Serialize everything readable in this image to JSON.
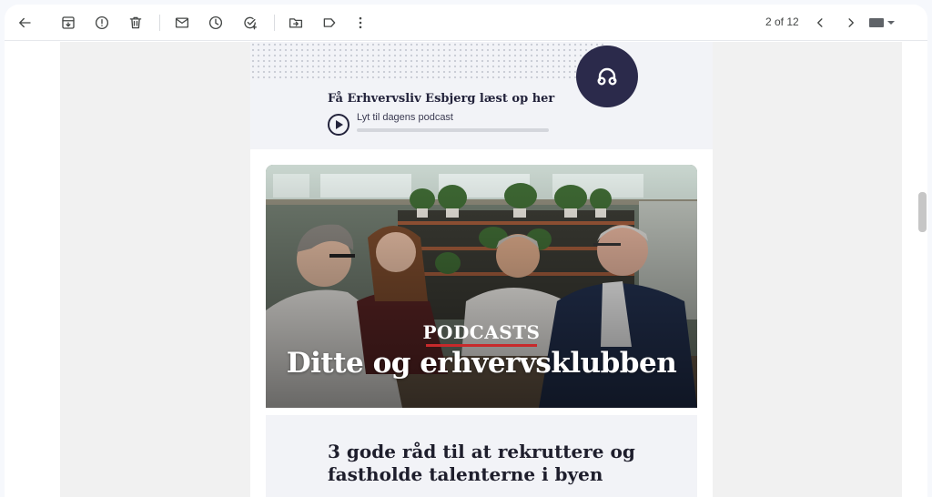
{
  "toolbar": {
    "back_icon": "arrow-left-icon",
    "archive_icon": "archive-icon",
    "spam_icon": "report-spam-icon",
    "delete_icon": "trash-icon",
    "mark_unread_icon": "envelope-icon",
    "snooze_icon": "clock-icon",
    "add_task_icon": "add-task-icon",
    "move_icon": "folder-move-icon",
    "label_icon": "label-icon",
    "more_icon": "more-vert-icon",
    "pagination": "2 of 12",
    "older_icon": "chevron-left-icon",
    "newer_icon": "chevron-right-icon",
    "input_tools_icon": "keyboard-icon"
  },
  "email": {
    "podcast_bar": {
      "title": "Få Erhvervsliv Esbjerg læst op her",
      "subtitle": "Lyt til dagens podcast",
      "icon": "headphones-icon",
      "play_icon": "play-icon",
      "progress": 0
    },
    "hero": {
      "label": "PODCASTS",
      "title": "Ditte og erhvervsklubben"
    },
    "article": {
      "title": "3 gode råd til at rekruttere og fastholde talenterne i byen"
    }
  },
  "colors": {
    "accent_navy": "#2b2a4b",
    "accent_red": "#c8292b",
    "panel_bg": "#f2f3f7"
  }
}
